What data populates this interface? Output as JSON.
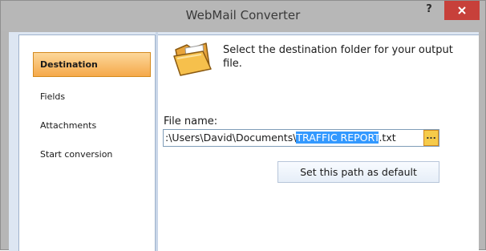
{
  "window": {
    "title": "WebMail Converter",
    "help_label": "?"
  },
  "sidebar": {
    "items": [
      {
        "label": "Destination",
        "selected": true
      },
      {
        "label": "Fields",
        "selected": false
      },
      {
        "label": "Attachments",
        "selected": false
      },
      {
        "label": "Start conversion",
        "selected": false
      }
    ]
  },
  "destination": {
    "instruction": "Select the destination folder for your output file.",
    "file_name_label": "File name:",
    "path_prefix": ":\\Users\\David\\Documents\\",
    "path_selected": "TRAFFIC REPORT",
    "path_suffix": ".txt",
    "browse_label": "...",
    "set_default_label": "Set this path as default"
  },
  "colors": {
    "selection_highlight": "#3399ff",
    "nav_selected": "#f5a94a",
    "close_button": "#c7403a"
  },
  "icons": {
    "folder": "open-folder-icon",
    "close": "close-icon"
  }
}
